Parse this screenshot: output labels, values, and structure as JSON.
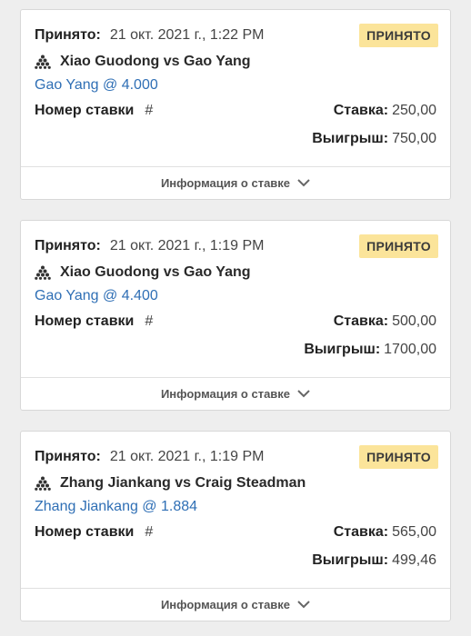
{
  "bets": [
    {
      "accepted_label": "Принято:",
      "accepted_date": "21 окт. 2021 г., 1:22 PM",
      "status": "ПРИНЯТО",
      "match": "Xiao Guodong vs Gao Yang",
      "sport_icon": "snooker-balls-icon",
      "pick": "Gao Yang @ 4.000",
      "bet_number_label": "Номер ставки",
      "bet_number_hash": "#",
      "stake_label": "Ставка:",
      "stake_value": "250,00",
      "win_label": "Выигрыш:",
      "win_value": "750,00",
      "details_label": "Информация о ставке"
    },
    {
      "accepted_label": "Принято:",
      "accepted_date": "21 окт. 2021 г., 1:19 PM",
      "status": "ПРИНЯТО",
      "match": "Xiao Guodong vs Gao Yang",
      "sport_icon": "snooker-balls-icon",
      "pick": "Gao Yang @ 4.400",
      "bet_number_label": "Номер ставки",
      "bet_number_hash": "#",
      "stake_label": "Ставка:",
      "stake_value": "500,00",
      "win_label": "Выигрыш:",
      "win_value": "1700,00",
      "details_label": "Информация о ставке"
    },
    {
      "accepted_label": "Принято:",
      "accepted_date": "21 окт. 2021 г., 1:19 PM",
      "status": "ПРИНЯТО",
      "match": "Zhang Jiankang vs Craig Steadman",
      "sport_icon": "snooker-balls-icon",
      "pick": "Zhang Jiankang @ 1.884",
      "bet_number_label": "Номер ставки",
      "bet_number_hash": "#",
      "stake_label": "Ставка:",
      "stake_value": "565,00",
      "win_label": "Выигрыш:",
      "win_value": "499,46",
      "details_label": "Информация о ставке"
    }
  ],
  "colors": {
    "badge_bg": "#fbe49a",
    "pick_link": "#2f6fb5",
    "page_bg": "#eeeeee"
  }
}
